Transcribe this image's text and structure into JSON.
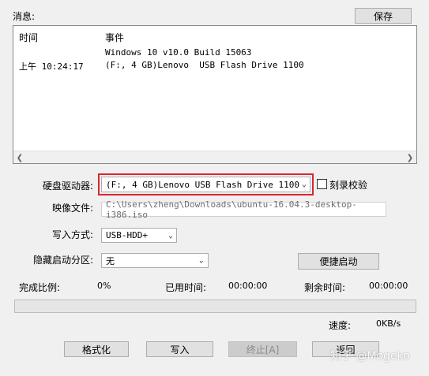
{
  "messages": {
    "label": "消息:",
    "save_button": "保存",
    "col_time": "时间",
    "col_event": "事件",
    "rows": [
      {
        "time": "",
        "event": "Windows 10 v10.0 Build 15063"
      },
      {
        "time": "上午 10:24:17",
        "event": "(F:, 4 GB)Lenovo  USB Flash Drive 1100"
      }
    ]
  },
  "form": {
    "drive_label": "硬盘驱动器:",
    "drive_value": "(F:, 4 GB)Lenovo  USB Flash Drive 1100",
    "verify_label": "刻录校验",
    "verify_checked": false,
    "image_label": "映像文件:",
    "image_value": "C:\\Users\\zheng\\Downloads\\ubuntu-16.04.3-desktop-i386.iso",
    "write_mode_label": "写入方式:",
    "write_mode_value": "USB-HDD+",
    "hidden_part_label": "隐藏启动分区:",
    "hidden_part_value": "无",
    "quick_boot_button": "便捷启动"
  },
  "status": {
    "complete_label": "完成比例:",
    "complete_value": "0%",
    "elapsed_label": "已用时间:",
    "elapsed_value": "00:00:00",
    "remaining_label": "剩余时间:",
    "remaining_value": "00:00:00",
    "progress_fraction": 0,
    "speed_label": "速度:",
    "speed_value": "0KB/s"
  },
  "actions": {
    "format": "格式化",
    "write": "写入",
    "abort": "终止[A]",
    "back": "返回"
  },
  "watermark": "知乎 @Mogeko",
  "colors": {
    "highlight_box": "#d9262c",
    "window_bg": "#f0f0f0"
  }
}
